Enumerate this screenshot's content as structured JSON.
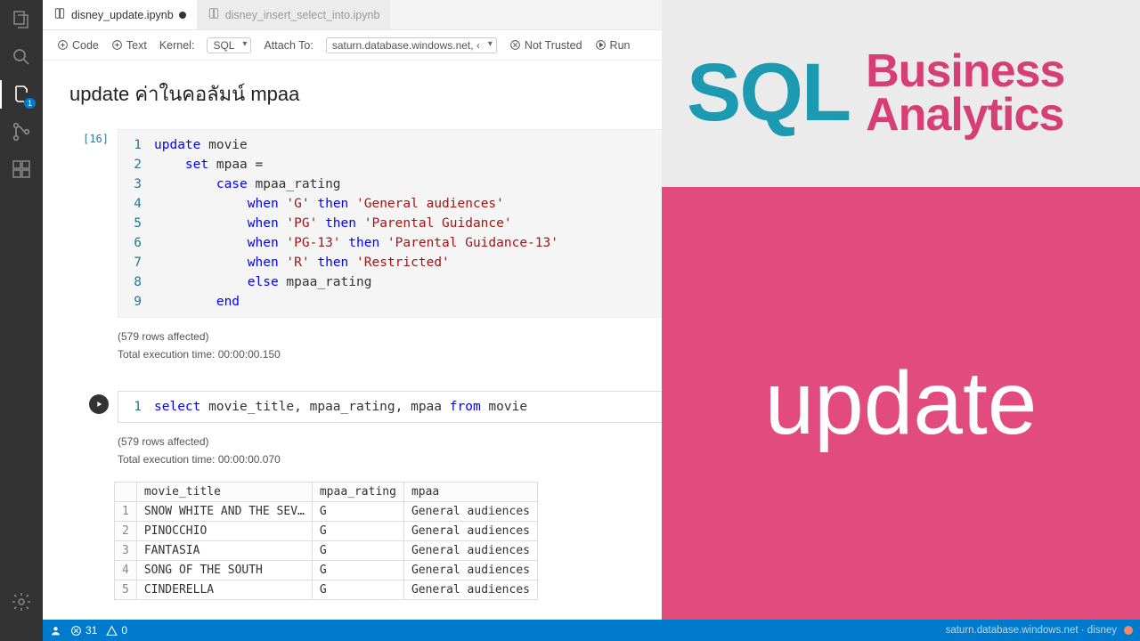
{
  "tabs": [
    {
      "label": "disney_update.ipynb",
      "active": true,
      "dirty": true
    },
    {
      "label": "disney_insert_select_into.ipynb",
      "active": false,
      "dirty": false
    }
  ],
  "toolbar": {
    "code": "Code",
    "text": "Text",
    "kernel_label": "Kernel:",
    "kernel_value": "SQL",
    "attach_label": "Attach To:",
    "attach_value": "saturn.database.windows.net, ‹",
    "trust": "Not Trusted",
    "run": "Run"
  },
  "notebook": {
    "markdown_title": "update ค่าในคอลัมน์ mpaa",
    "cell1": {
      "exec_count": "[16]",
      "lines": [
        "1",
        "2",
        "3",
        "4",
        "5",
        "6",
        "7",
        "8",
        "9"
      ],
      "rows_affected": "(579 rows affected)",
      "exec_time": "Total execution time: 00:00:00.150"
    },
    "cell2": {
      "line": "1",
      "rows_affected": "(579 rows affected)",
      "exec_time": "Total execution time: 00:00:00.070",
      "headers": [
        "",
        "movie_title",
        "mpaa_rating",
        "mpaa"
      ],
      "rows": [
        [
          "1",
          "SNOW WHITE AND THE SEV…",
          "G",
          "General audiences"
        ],
        [
          "2",
          "PINOCCHIO",
          "G",
          "General audiences"
        ],
        [
          "3",
          "FANTASIA",
          "G",
          "General audiences"
        ],
        [
          "4",
          "SONG OF THE SOUTH",
          "G",
          "General audiences"
        ],
        [
          "5",
          "CINDERELLA",
          "G",
          "General audiences"
        ]
      ]
    }
  },
  "overlay": {
    "sql": "SQL",
    "business": "Business",
    "analytics": "Analytics",
    "update": "update"
  },
  "statusbar": {
    "errors": "31",
    "warnings": "0",
    "conn": "saturn.database.windows.net · disney"
  },
  "activity_badge": "1"
}
